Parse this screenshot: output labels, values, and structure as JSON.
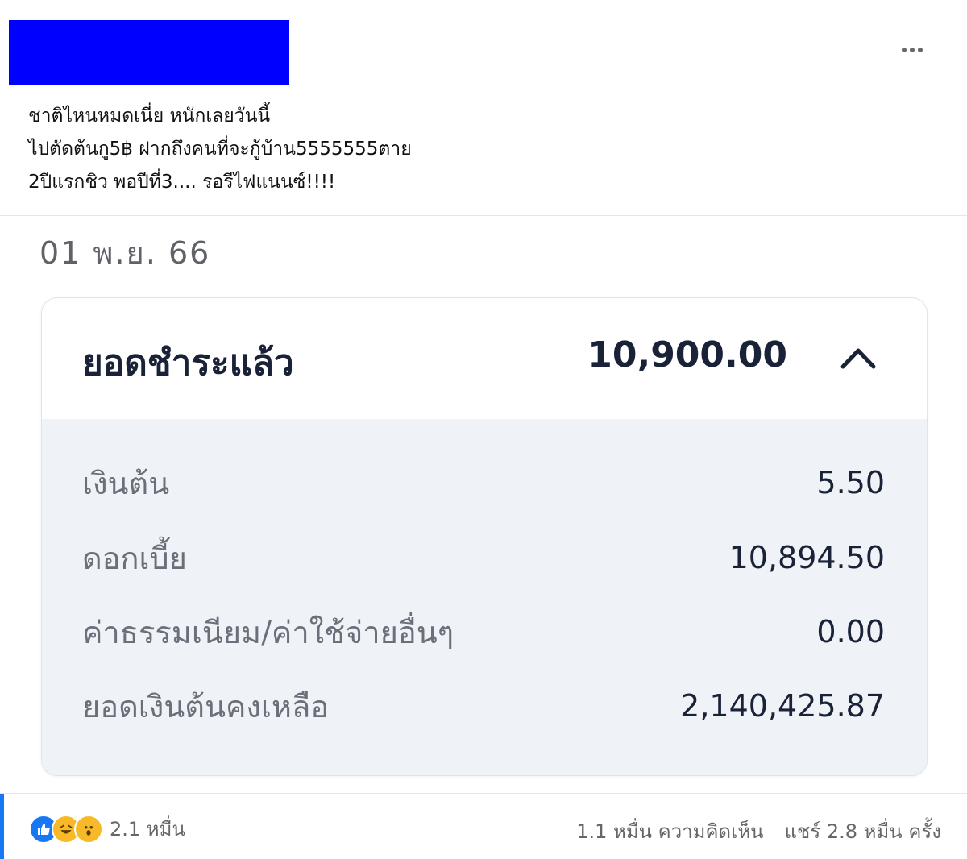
{
  "post": {
    "lines": [
      "ชาติไหนหมดเนี่ย หนักเลยวันนี้",
      "ไปตัดต้นกู5฿ ฝากถึงคนที่จะกู้บ้าน5555555ตาย",
      "2ปีแรกชิว พอปีที่3.... รอรีไฟแนนซ์!!!!"
    ],
    "more_icon": "ellipsis-icon"
  },
  "slip": {
    "date": "01 พ.ย. 66",
    "summary_label": "ยอดชำระแล้ว",
    "summary_amount": "10,900.00",
    "toggle_icon": "chevron-up-icon",
    "rows": [
      {
        "label": "เงินต้น",
        "value": "5.50"
      },
      {
        "label": "ดอกเบี้ย",
        "value": "10,894.50"
      },
      {
        "label": "ค่าธรรมเนียม/ค่าใช้จ่ายอื่นๆ",
        "value": "0.00"
      },
      {
        "label": "ยอดเงินต้นคงเหลือ",
        "value": "2,140,425.87"
      }
    ]
  },
  "footer": {
    "reaction_icons": [
      "like-icon",
      "haha-icon",
      "wow-icon"
    ],
    "reaction_count": "2.1 หมื่น",
    "comments": "1.1 หมื่น ความคิดเห็น",
    "shares": "แชร์ 2.8 หมื่น ครั้ง"
  },
  "colors": {
    "redaction": "#0000fe",
    "accent": "#1877f2",
    "card_body": "#eff3f8",
    "amount_text": "#1a2238"
  }
}
